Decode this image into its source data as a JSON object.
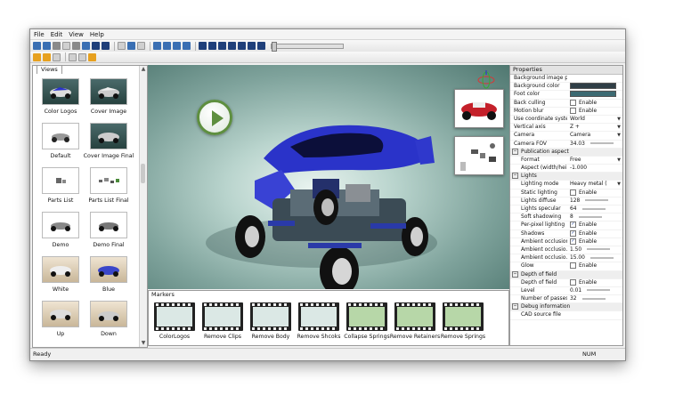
{
  "menu": [
    "File",
    "Edit",
    "View",
    "Help"
  ],
  "views": {
    "tab_label": "Views",
    "items": [
      {
        "label": "Color Logos"
      },
      {
        "label": "Cover Image"
      },
      {
        "label": "Default"
      },
      {
        "label": "Cover Image Final"
      },
      {
        "label": "Parts List"
      },
      {
        "label": "Parts List Final"
      },
      {
        "label": "Demo"
      },
      {
        "label": "Demo Final"
      },
      {
        "label": "White"
      },
      {
        "label": "Blue"
      },
      {
        "label": "Up"
      },
      {
        "label": "Down"
      }
    ]
  },
  "markers": {
    "title": "Markers",
    "items": [
      {
        "label": "ColorLogos"
      },
      {
        "label": "Remove Clips"
      },
      {
        "label": "Remove Body"
      },
      {
        "label": "Remove Shcoks"
      },
      {
        "label": "Collapse Springs"
      },
      {
        "label": "Remove Retainers"
      },
      {
        "label": "Remove Springs"
      }
    ]
  },
  "properties": {
    "title": "Properties",
    "rows": [
      {
        "name": "Background image p...",
        "value": ""
      },
      {
        "name": "Background color",
        "value": "",
        "swatch": "#2f3e46"
      },
      {
        "name": "Foot color",
        "value": "",
        "swatch": "#3c6a72"
      },
      {
        "name": "Back culling",
        "value": "Enable",
        "checked": false
      },
      {
        "name": "Motion blur",
        "value": "Enable",
        "checked": false
      },
      {
        "name": "Use coordinate system",
        "value": "World",
        "dropdown": true
      },
      {
        "name": "Vertical axis",
        "value": "Z +",
        "dropdown": true
      },
      {
        "name": "Camera",
        "value": "Camera",
        "dropdown": true
      },
      {
        "name": "Camera FOV",
        "value": "34.03",
        "slider": true
      },
      {
        "name": "Publication aspect",
        "section": true
      },
      {
        "name": "Format",
        "value": "Free",
        "dropdown": true,
        "sub": true
      },
      {
        "name": "Aspect (width/hei...",
        "value": "-1.000",
        "sub": true
      },
      {
        "name": "Lights",
        "section": true
      },
      {
        "name": "Lighting mode",
        "value": "Heavy metal (",
        "dropdown": true,
        "sub": true
      },
      {
        "name": "Static lighting",
        "value": "Enable",
        "checked": false,
        "sub": true
      },
      {
        "name": "Lights diffuse",
        "value": "128",
        "slider": true,
        "sub": true
      },
      {
        "name": "Lights specular",
        "value": "64",
        "slider": true,
        "sub": true
      },
      {
        "name": "Soft shadowing",
        "value": "8",
        "slider": true,
        "sub": true
      },
      {
        "name": "Per-pixel lighting",
        "value": "Enable",
        "checked": true,
        "sub": true
      },
      {
        "name": "Shadows",
        "value": "Enable",
        "checked": true,
        "sub": true
      },
      {
        "name": "Ambient occlusion",
        "value": "Enable",
        "checked": true,
        "sub": true
      },
      {
        "name": "Ambient occlusio...",
        "value": "1.50",
        "slider": true,
        "sub": true
      },
      {
        "name": "Ambient occlusio...",
        "value": "15.00",
        "slider": true,
        "sub": true
      },
      {
        "name": "Glow",
        "value": "Enable",
        "checked": false,
        "sub": true
      },
      {
        "name": "Depth of field",
        "section": true
      },
      {
        "name": "Depth of field",
        "value": "Enable",
        "checked": false,
        "sub": true
      },
      {
        "name": "Level",
        "value": "0.01",
        "slider": true,
        "sub": true
      },
      {
        "name": "Number of passes",
        "value": "32",
        "slider": true,
        "sub": true
      },
      {
        "name": "Debug information",
        "section": true
      },
      {
        "name": "CAD source file",
        "value": "",
        "sub": true
      }
    ]
  },
  "status": {
    "left": "Ready",
    "right": "NUM"
  },
  "colors": {
    "viewport_center": "#e8f3ef",
    "viewport_edge": "#4f7770",
    "car_body": "#2a33c9",
    "play_green": "#5e8f3f"
  }
}
